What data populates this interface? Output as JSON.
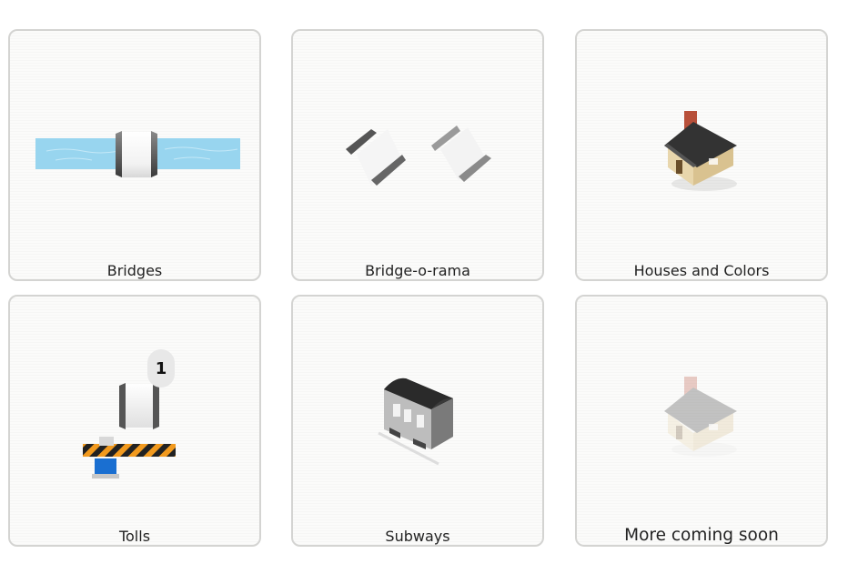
{
  "cards": [
    {
      "label": "Bridges",
      "icon": "bridge-icon"
    },
    {
      "label": "Bridge-o-rama",
      "icon": "bridge-pieces-icon"
    },
    {
      "label": "Houses and Colors",
      "icon": "house-icon"
    },
    {
      "label": "Tolls",
      "icon": "toll-gate-icon",
      "badge": "1"
    },
    {
      "label": "Subways",
      "icon": "subway-car-icon"
    },
    {
      "label": "More coming soon",
      "icon": "faded-house-icon"
    }
  ],
  "colors": {
    "water": "#98d5ef",
    "roof": "#333333",
    "chimney": "#b8503a",
    "house_wall": "#e8d6ac",
    "toll_stripe": "#f29a1e",
    "toll_post": "#1a6fd1"
  }
}
